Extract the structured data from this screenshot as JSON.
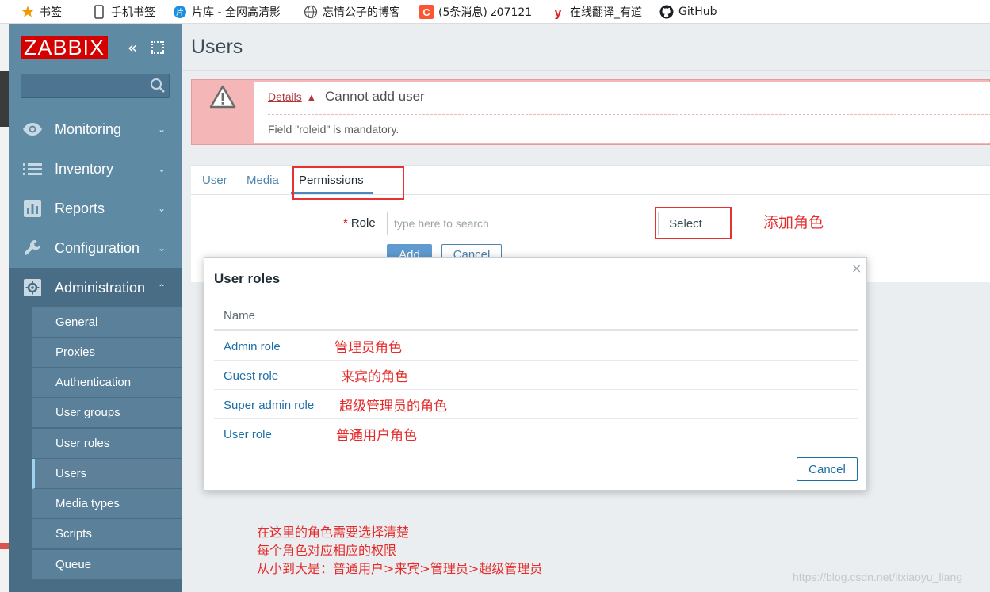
{
  "bookmarks": [
    {
      "icon": "star-icon",
      "label": "书签"
    },
    {
      "icon": "phone-icon",
      "label": "手机书签"
    },
    {
      "icon": "pianku-icon",
      "label": "片库 - 全网高清影"
    },
    {
      "icon": "globe-icon",
      "label": "忘情公子的博客"
    },
    {
      "icon": "csdn-icon",
      "label": "(5条消息) z07121"
    },
    {
      "icon": "youdao-icon",
      "label": "在线翻译_有道"
    },
    {
      "icon": "github-icon",
      "label": "GitHub"
    }
  ],
  "sidebar": {
    "logo": "ZABBIX",
    "menu": [
      {
        "label": "Monitoring",
        "icon": "eye-icon"
      },
      {
        "label": "Inventory",
        "icon": "list-icon"
      },
      {
        "label": "Reports",
        "icon": "bar-chart-icon"
      },
      {
        "label": "Configuration",
        "icon": "wrench-icon"
      },
      {
        "label": "Administration",
        "icon": "gear-icon"
      }
    ],
    "submenu": [
      "General",
      "Proxies",
      "Authentication",
      "User groups",
      "User roles",
      "Users",
      "Media types",
      "Scripts",
      "Queue"
    ]
  },
  "page": {
    "title": "Users"
  },
  "error": {
    "details_label": "Details",
    "title": "Cannot add user",
    "message": "Field \"roleid\" is mandatory."
  },
  "form": {
    "tabs": [
      "User",
      "Media",
      "Permissions"
    ],
    "active_tab": "Permissions",
    "role_label": "Role",
    "role_placeholder": "type here to search",
    "select_label": "Select",
    "add_label": "Add",
    "cancel_label": "Cancel"
  },
  "modal": {
    "title": "User roles",
    "close_symbol": "×",
    "column_name": "Name",
    "roles": [
      {
        "name": "Admin role",
        "note": "管理员角色"
      },
      {
        "name": "Guest role",
        "note": "来宾的角色"
      },
      {
        "name": "Super admin role",
        "note": "超级管理员的角色"
      },
      {
        "name": "User role",
        "note": "普通用户角色"
      }
    ],
    "cancel_label": "Cancel"
  },
  "annotations": {
    "add_role": "添加角色",
    "bottom_lines": [
      "在这里的角色需要选择清楚",
      "每个角色对应相应的权限",
      "从小到大是：普通用户>来宾>管理员>超级管理员"
    ]
  },
  "watermark": "https://blog.csdn.net/itxiaoyu_liang",
  "colors": {
    "sidebar": "#5f8aa4",
    "logo_red": "#d40000",
    "link_blue": "#1c6ea4",
    "error_pink": "#f4b6b6",
    "annotation_red": "#e52c2c"
  }
}
